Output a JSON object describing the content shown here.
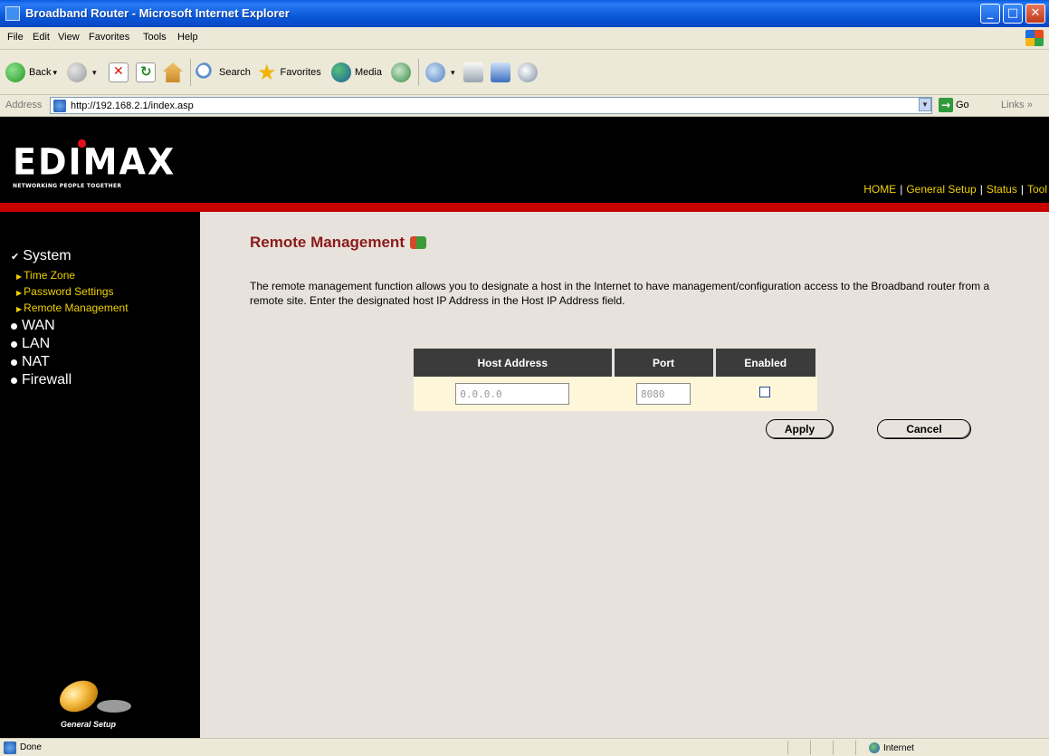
{
  "window": {
    "title": "Broadband Router - Microsoft Internet Explorer",
    "controls": {
      "minimize": "_",
      "maximize": "□",
      "close": "✕"
    }
  },
  "menu": {
    "items": [
      "File",
      "Edit",
      "View",
      "Favorites",
      "Tools",
      "Help"
    ]
  },
  "toolbar": {
    "back": "Back",
    "search": "Search",
    "favorites": "Favorites",
    "media": "Media"
  },
  "address": {
    "label": "Address",
    "url": "http://192.168.2.1/index.asp",
    "go": "Go",
    "links": "Links »"
  },
  "header": {
    "logo": "EDIMAX",
    "tagline": "NETWORKING PEOPLE TOGETHER",
    "nav": [
      "HOME",
      "General Setup",
      "Status",
      "Tool"
    ],
    "colors": {
      "accent_red": "#c70000",
      "nav_yellow": "#f0d000"
    }
  },
  "sidebar": {
    "system": "System",
    "system_items": [
      "Time Zone",
      "Password Settings",
      "Remote Management"
    ],
    "sections": [
      "WAN",
      "LAN",
      "NAT",
      "Firewall"
    ],
    "footer_label": "General Setup"
  },
  "content": {
    "title": "Remote Management",
    "description": "The remote management function allows you to designate a host in the Internet to have management/configuration access to the Broadband router from a remote site. Enter the designated host IP Address in the Host IP Address field.",
    "table": {
      "headers": {
        "host": "Host Address",
        "port": "Port",
        "enabled": "Enabled"
      },
      "host_value": "0.0.0.0",
      "port_value": "8080",
      "enabled": false
    },
    "buttons": {
      "apply": "Apply",
      "cancel": "Cancel"
    }
  },
  "status": {
    "text": "Done",
    "zone": "Internet"
  }
}
